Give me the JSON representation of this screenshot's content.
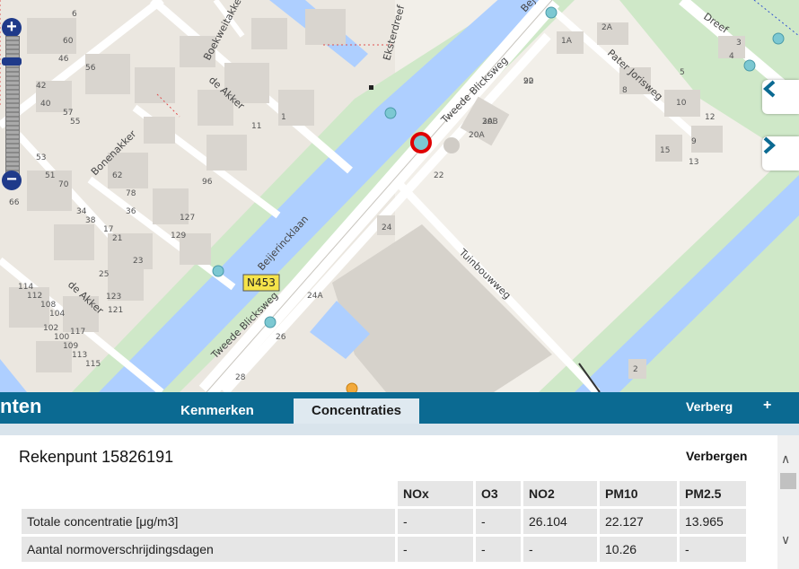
{
  "map": {
    "street_labels": {
      "beijerincklaan": "Beijerincklaan",
      "beijer_top": "Bej",
      "tweede_blicksweg_a": "Tweede Blicksweg",
      "tweede_blicksweg_b": "Tweede Blicksweg",
      "tuinbouwweg": "Tuinbouwweg",
      "pater_jorisweg": "Pater Jorisweg",
      "eksterdreef": "Eksterdreef",
      "dreef": "Dreef",
      "boekweitakker": "Boekweitakker",
      "de_akker_a": "de Akker",
      "de_akker_b": "de Akker",
      "bonenakker": "Bonenakker"
    },
    "road_shield": "N453",
    "house_numbers": [
      "20",
      "20B",
      "20A",
      "22",
      "24",
      "24A",
      "26",
      "28",
      "2",
      "1A",
      "2A",
      "8",
      "10",
      "12",
      "13",
      "15",
      "1",
      "3",
      "4",
      "5",
      "9",
      "11",
      "6",
      "60",
      "56",
      "42",
      "40",
      "46",
      "57",
      "55",
      "53",
      "51",
      "70",
      "66",
      "62",
      "78",
      "36",
      "34",
      "38",
      "17",
      "21",
      "23",
      "25",
      "114",
      "112",
      "108",
      "104",
      "102",
      "100",
      "109",
      "113",
      "115",
      "117",
      "121",
      "123",
      "125",
      "127",
      "129",
      "96",
      "92",
      "3A"
    ]
  },
  "panel": {
    "title": "nten",
    "tabs": [
      "Kenmerken",
      "Concentraties"
    ],
    "active_tab": "Concentraties",
    "verberg": "Verberg",
    "plus": "+"
  },
  "content": {
    "title": "Rekenpunt 15826191",
    "verbergen": "Verbergen",
    "table": {
      "headers": [
        "",
        "NOx",
        "O3",
        "NO2",
        "PM10",
        "PM2.5"
      ],
      "rows": [
        [
          "Totale concentratie [μg/m3]",
          "-",
          "-",
          "26.104",
          "22.127",
          "13.965"
        ],
        [
          "Aantal normoverschrijdingsdagen",
          "-",
          "-",
          "-",
          "10.26",
          "-"
        ]
      ]
    }
  },
  "colors": {
    "panel_bar": "#0b6a92",
    "active_tab": "#dfe9f0",
    "water": "#b3d1ff",
    "grass": "#cbe6c5",
    "selected_marker": "#e00000",
    "point_marker": "#7cc8d2"
  }
}
